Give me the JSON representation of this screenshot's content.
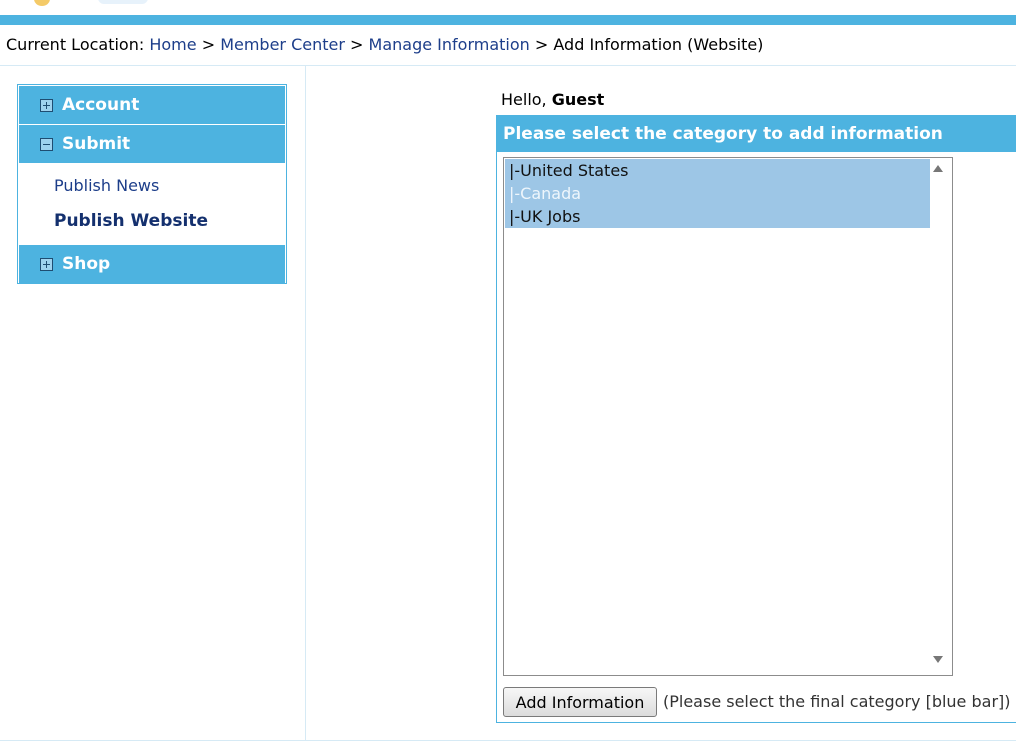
{
  "breadcrumb": {
    "prefix": "Current Location:",
    "home": "Home",
    "member_center": "Member Center",
    "manage_information": "Manage Information",
    "current": "Add Information (Website)",
    "separator": ">"
  },
  "sidebar": {
    "account": "Account",
    "submit": "Submit",
    "publish_news": "Publish News",
    "publish_website": "Publish Website",
    "shop": "Shop"
  },
  "greeting": {
    "hello": "Hello,",
    "user": "Guest"
  },
  "panel": {
    "title": "Please select the category to add information",
    "options": [
      "|-United States",
      "|-Canada",
      "|-UK Jobs"
    ],
    "button_label": "Add Information",
    "hint": "(Please select the final category [blue bar])"
  },
  "colors": {
    "accent": "#4db3e0",
    "selected_option": "#9dc6e6",
    "link": "#1d3e8a"
  }
}
